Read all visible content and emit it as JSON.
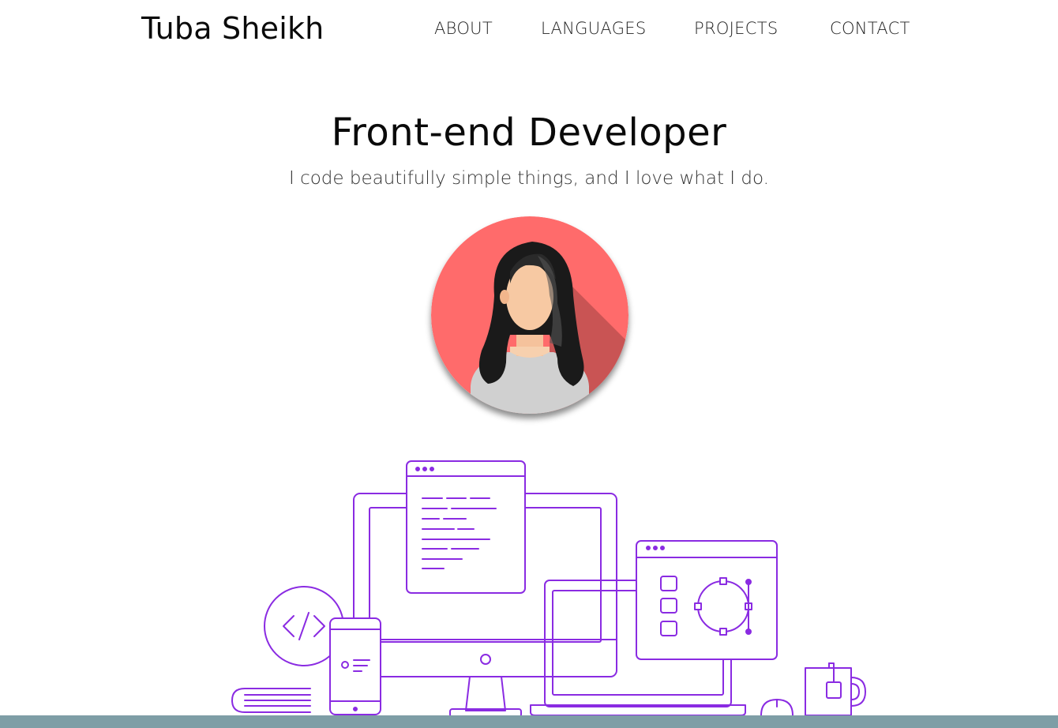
{
  "header": {
    "brand": "Tuba Sheikh",
    "nav": [
      {
        "label": "ABOUT"
      },
      {
        "label": "LANGUAGES"
      },
      {
        "label": "PROJECTS"
      },
      {
        "label": "CONTACT"
      }
    ]
  },
  "hero": {
    "title": "Front-end Developer",
    "subtitle": "I code beautifully simple things, and I love what I do."
  },
  "colors": {
    "avatar_bg": "#ff6b6b",
    "illustration_stroke": "#8a2be2",
    "footer_bar": "#7e9ea6"
  },
  "icons": {
    "avatar": "woman-avatar-icon",
    "illustration": "devices-workspace-illustration"
  }
}
